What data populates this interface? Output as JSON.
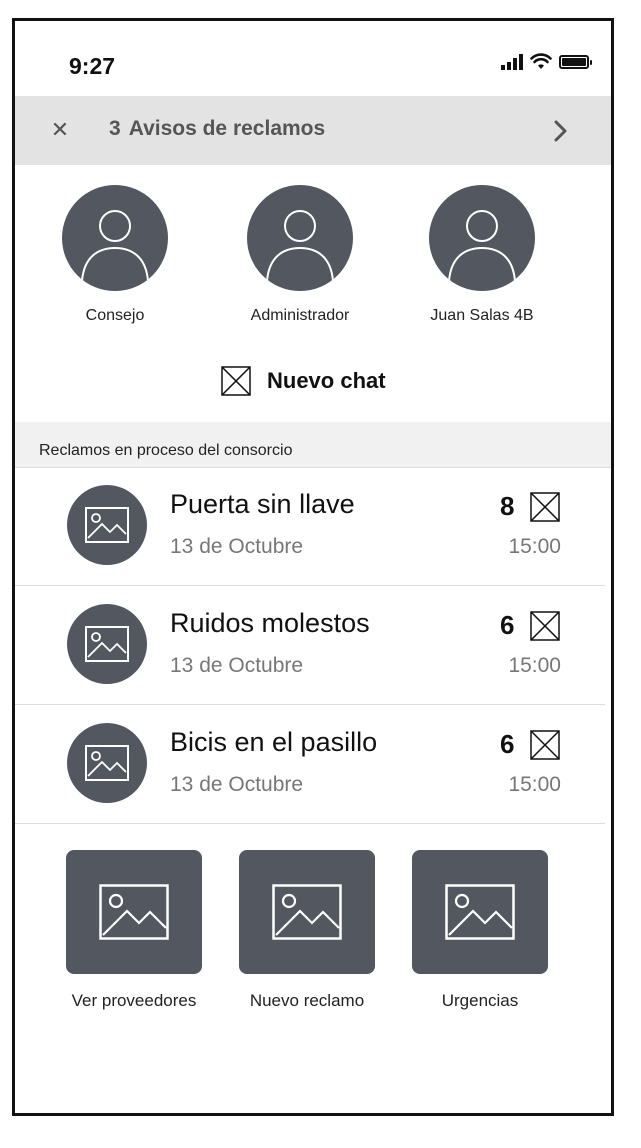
{
  "status_bar": {
    "time": "9:27",
    "icons": [
      "signal-icon",
      "wifi-icon",
      "battery-icon"
    ]
  },
  "notice": {
    "count": "3",
    "label": "Avisos de reclamos",
    "close_icon": "close-icon",
    "chevron_icon": "chevron-right-icon"
  },
  "contacts": [
    {
      "label": "Consejo",
      "icon": "user-icon"
    },
    {
      "label": "Administrador",
      "icon": "user-icon"
    },
    {
      "label": "Juan Salas 4B",
      "icon": "user-icon"
    }
  ],
  "new_chat": {
    "label": "Nuevo chat",
    "icon": "placeholder-x-icon"
  },
  "section": {
    "title": "Reclamos en proceso del consorcio"
  },
  "claims": [
    {
      "title": "Puerta sin llave",
      "date": "13 de Octubre",
      "count": "8",
      "time": "15:00"
    },
    {
      "title": "Ruidos molestos",
      "date": "13 de Octubre",
      "count": "6",
      "time": "15:00"
    },
    {
      "title": "Bicis en el pasillo",
      "date": "13 de Octubre",
      "count": "6",
      "time": "15:00"
    }
  ],
  "actions": [
    {
      "label": "Ver proveedores",
      "icon": "image-icon"
    },
    {
      "label": "Nuevo reclamo",
      "icon": "image-icon"
    },
    {
      "label": "Urgencias",
      "icon": "image-icon"
    }
  ],
  "colors": {
    "avatar_bg": "#535760",
    "notice_bg": "#e3e3e3",
    "muted_text": "#777777"
  }
}
